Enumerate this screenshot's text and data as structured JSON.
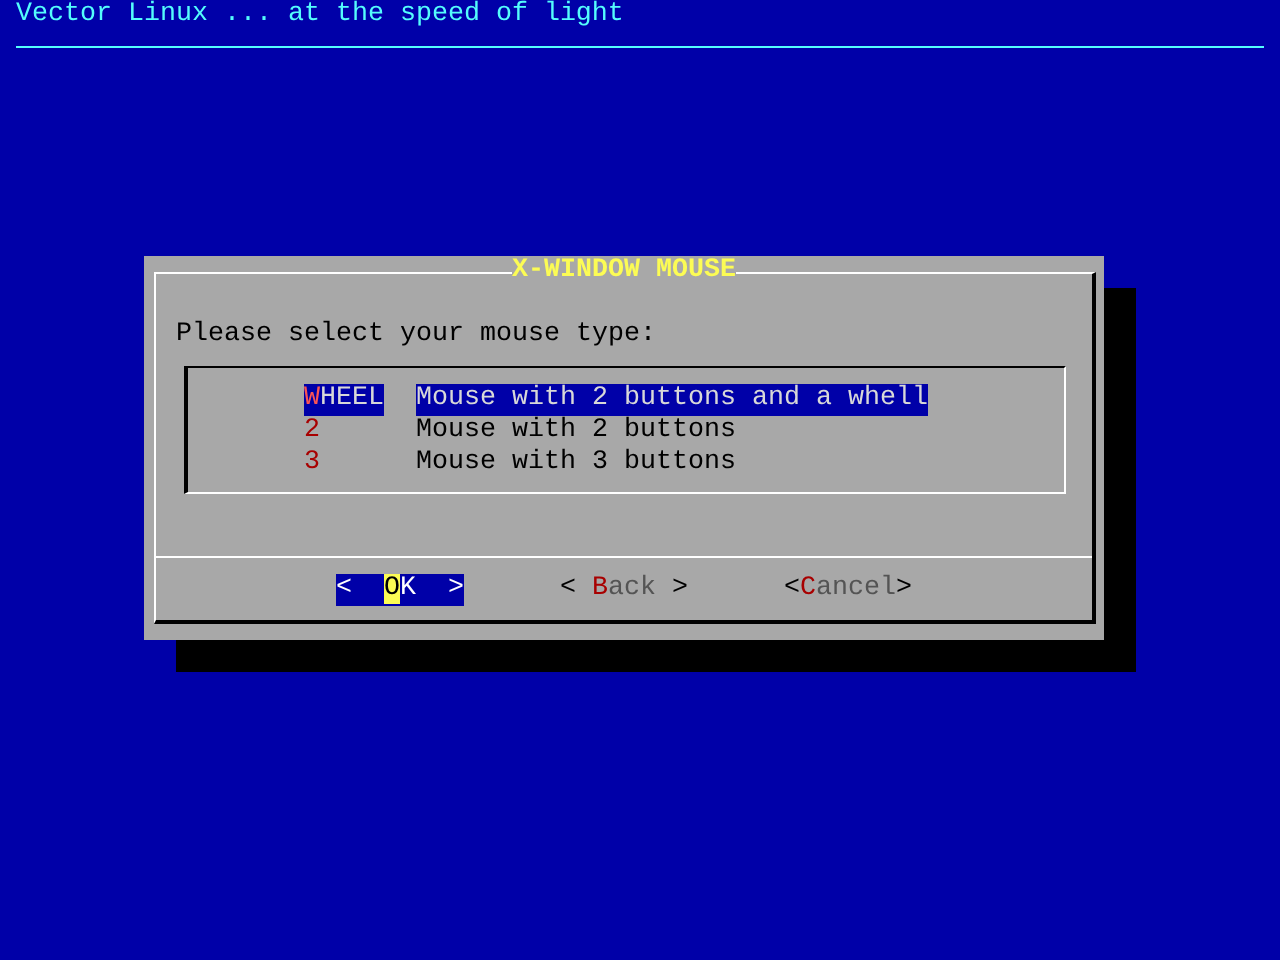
{
  "header": {
    "title": "Vector Linux ... at the speed of light"
  },
  "dialog": {
    "title": "X-WINDOW MOUSE",
    "prompt": "Please select your mouse type:",
    "items": [
      {
        "tag_hotkey": "W",
        "tag_rest": "HEEL",
        "description": "Mouse with 2 buttons and a whell",
        "selected": true
      },
      {
        "tag_hotkey": "2",
        "description": "Mouse with 2 buttons",
        "selected": false
      },
      {
        "tag_hotkey": "3",
        "description": "Mouse with 3 buttons",
        "selected": false
      }
    ],
    "buttons": [
      {
        "open": "<  ",
        "hotkey": "O",
        "rest": "K",
        "close": "  >",
        "selected": true
      },
      {
        "open": "< ",
        "hotkey": "B",
        "rest": "ack",
        "close": " >",
        "selected": false
      },
      {
        "open": "<",
        "hotkey": "C",
        "rest": "ancel",
        "close": ">",
        "selected": false
      }
    ]
  }
}
